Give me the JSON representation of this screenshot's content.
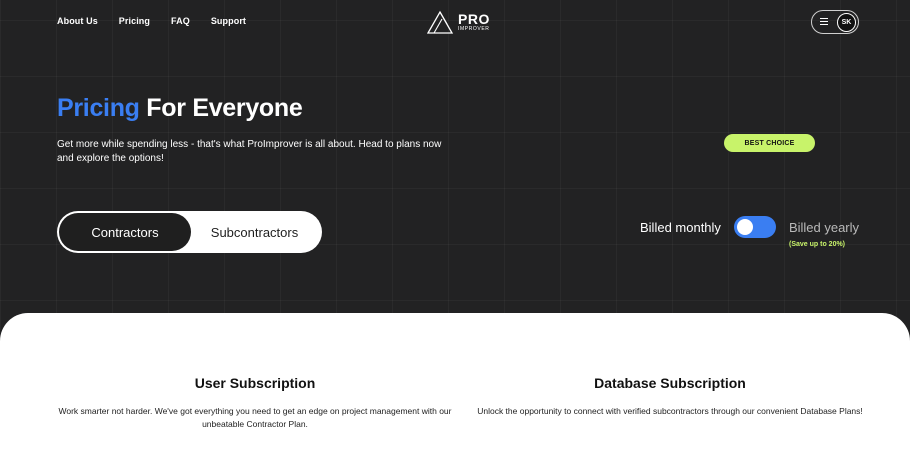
{
  "nav": {
    "items": [
      "About Us",
      "Pricing",
      "FAQ",
      "Support"
    ]
  },
  "logo": {
    "line1": "PRO",
    "line2": "IMPROVER"
  },
  "user": {
    "initials": "SK"
  },
  "hero": {
    "title_accent": "Pricing",
    "title_rest": " For Everyone",
    "subtitle": "Get more while spending less - that's what ProImprover is all about. Head to plans now and explore the options!"
  },
  "tabs": [
    {
      "label": "Contractors",
      "active": true
    },
    {
      "label": "Subcontractors",
      "active": false
    }
  ],
  "billing": {
    "monthly_label": "Billed monthly",
    "yearly_label": "Billed yearly",
    "save_note": "(Save up to 20%)"
  },
  "plans": [
    {
      "title": "User Subscription",
      "description": "Work smarter not harder. We've got everything you need to get an edge on project management with our unbeatable Contractor Plan."
    },
    {
      "title": "Database Subscription",
      "description": "Unlock the opportunity to connect with verified subcontractors through our convenient Database Plans!",
      "badge": "BEST CHOICE"
    }
  ],
  "colors": {
    "accent": "#3a7ef2",
    "highlight": "#c8f36a",
    "background": "#222223"
  }
}
